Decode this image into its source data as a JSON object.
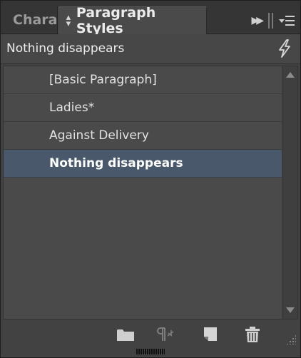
{
  "tabs": [
    {
      "label": "Chara",
      "active": false
    },
    {
      "label": "Paragraph Styles",
      "active": true
    }
  ],
  "icons": {
    "tab_sort": "up-down-arrows-icon",
    "expand": "double-chevron-right-icon",
    "grip": "panel-grip-icon",
    "menu": "panel-menu-icon",
    "quick_apply": "lightning-icon",
    "new_group": "folder-icon",
    "clear_overrides": "clear-overrides-icon",
    "new_style": "new-style-icon",
    "delete": "trash-icon"
  },
  "current_style": "Nothing disappears",
  "styles": [
    {
      "name": "[Basic Paragraph]",
      "selected": false
    },
    {
      "name": "Ladies*",
      "selected": false
    },
    {
      "name": "Against Delivery",
      "selected": false
    },
    {
      "name": "Nothing disappears",
      "selected": true
    }
  ],
  "colors": {
    "panel_bg": "#424242",
    "list_bg": "#4a4a4a",
    "selection": "#49596b",
    "text": "#e2e2e2"
  }
}
